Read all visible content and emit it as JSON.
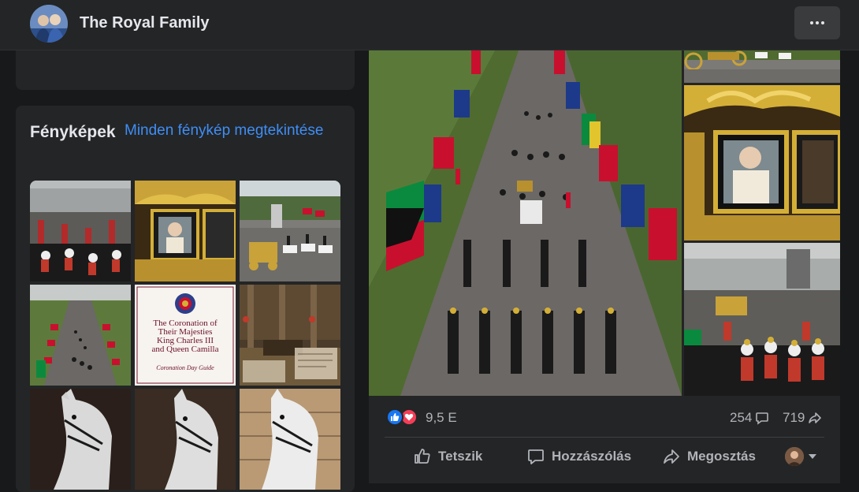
{
  "header": {
    "page_name": "The Royal Family",
    "avatar_icon": "profile-photo",
    "more_icon": "more-dots-icon"
  },
  "photos": {
    "title": "Fényképek",
    "see_all": "Minden fénykép megtekintése",
    "tiles": [
      {
        "name": "photo-procession-palace"
      },
      {
        "name": "photo-gold-state-coach"
      },
      {
        "name": "photo-coach-crowd"
      },
      {
        "name": "photo-the-mall-aerial"
      },
      {
        "name": "photo-coronation-guide",
        "line1": "The Coronation of",
        "line2": "Their Majesties",
        "line3": "King Charles III",
        "line4": "and Queen Camilla",
        "subtitle": "Coronation Day Guide"
      },
      {
        "name": "photo-abbey-interior"
      },
      {
        "name": "photo-horse-1"
      },
      {
        "name": "photo-horse-2"
      },
      {
        "name": "photo-horse-3"
      }
    ]
  },
  "post": {
    "reaction_count": "9,5 E",
    "comments": "254",
    "shares": "719",
    "actions": {
      "like": "Tetszik",
      "comment": "Hozzászólás",
      "share": "Megosztás"
    },
    "colors": {
      "like_blue": "#1877f2",
      "love_red": "#f33e58",
      "link_blue": "#3e8ef7"
    }
  }
}
